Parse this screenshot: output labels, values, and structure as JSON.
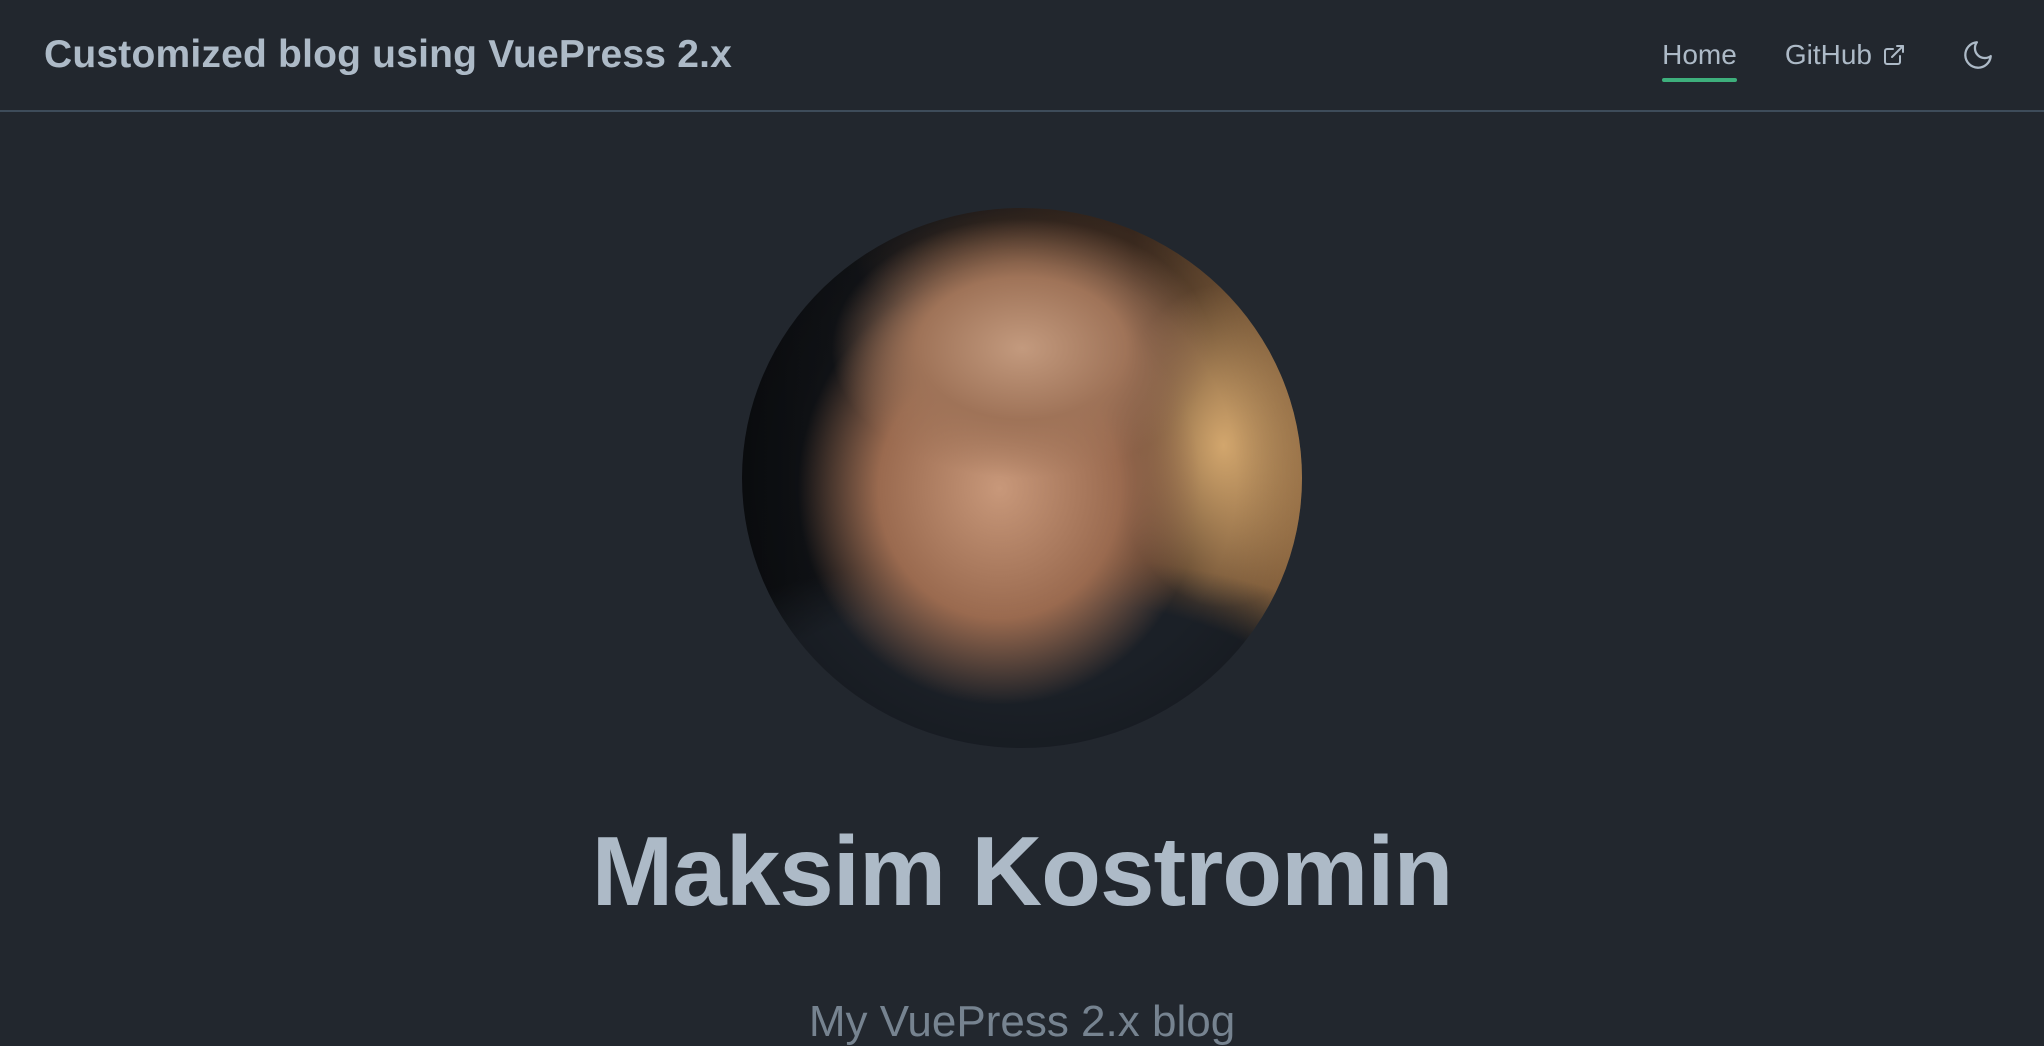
{
  "navbar": {
    "site_name": "Customized blog using VuePress 2.x",
    "links": [
      {
        "label": "Home",
        "active": true
      },
      {
        "label": "GitHub",
        "external": true,
        "icon": "external-link-icon"
      }
    ],
    "theme_toggle_icon": "moon-icon"
  },
  "hero": {
    "avatar_alt": "avatar photo",
    "name": "Maksim Kostromin",
    "tagline": "My VuePress 2.x blog"
  },
  "colors": {
    "background": "#22272e",
    "text": "#adbac7",
    "accent": "#3eaf7c",
    "border": "#3e4c5a"
  }
}
